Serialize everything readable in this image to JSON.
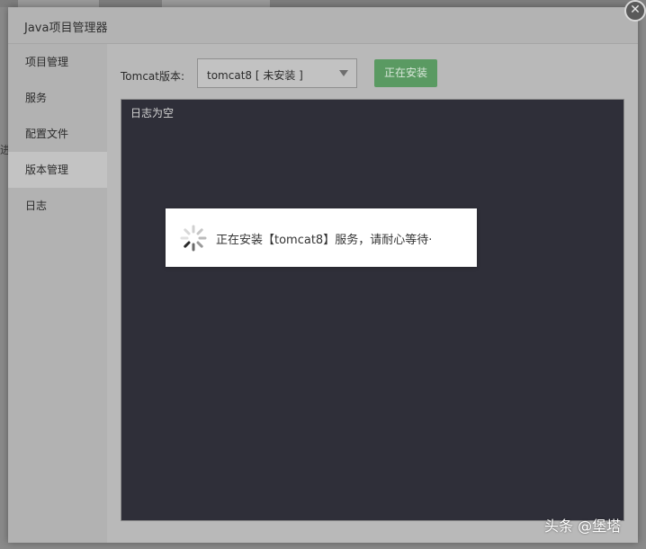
{
  "dialog": {
    "title": "Java项目管理器",
    "close_icon": "close-icon"
  },
  "background": {
    "left_text": "进"
  },
  "sidebar": {
    "items": [
      {
        "label": "项目管理"
      },
      {
        "label": "服务"
      },
      {
        "label": "配置文件"
      },
      {
        "label": "版本管理",
        "active": true
      },
      {
        "label": "日志"
      }
    ]
  },
  "toolbar": {
    "version_label": "Tomcat版本:",
    "selected_version": "tomcat8 [ 未安装 ]",
    "install_button": "正在安装"
  },
  "log": {
    "empty_text": "日志为空"
  },
  "loading": {
    "message": "正在安装【tomcat8】服务，请耐心等待·"
  },
  "watermark": {
    "text": "头条 @堡塔"
  },
  "colors": {
    "install_button": "#5a9a62",
    "log_background": "#2f2f39"
  }
}
